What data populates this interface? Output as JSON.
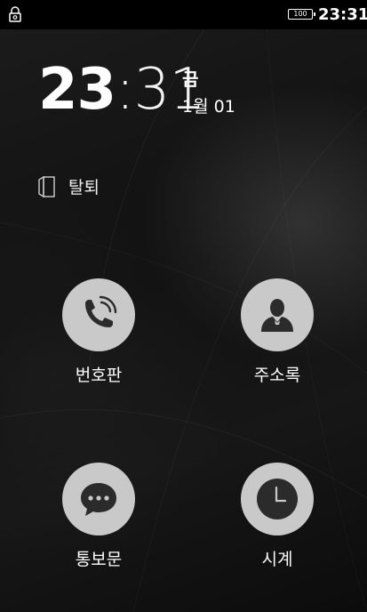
{
  "status_bar": {
    "battery_level": "100",
    "time": "23:31",
    "icons": [
      "lock-status-icon",
      "battery-icon"
    ]
  },
  "clock": {
    "hour": "23",
    "separator": ":",
    "minute": "31",
    "day_name": "금",
    "date": "1월 01"
  },
  "logout": {
    "label": "탈퇴",
    "icon": "door-exit-icon"
  },
  "shortcuts": [
    {
      "label": "번호판",
      "icon": "phone-icon"
    },
    {
      "label": "주소록",
      "icon": "contact-person-icon"
    },
    {
      "label": "통보문",
      "icon": "message-bubble-icon"
    },
    {
      "label": "시계",
      "icon": "clock-icon"
    }
  ],
  "colors": {
    "status_bar_bg": "#000000",
    "background": "#141414",
    "tile_circle": "#c9c9c9",
    "tile_icon": "#2b2b2b",
    "text": "#ffffff"
  }
}
